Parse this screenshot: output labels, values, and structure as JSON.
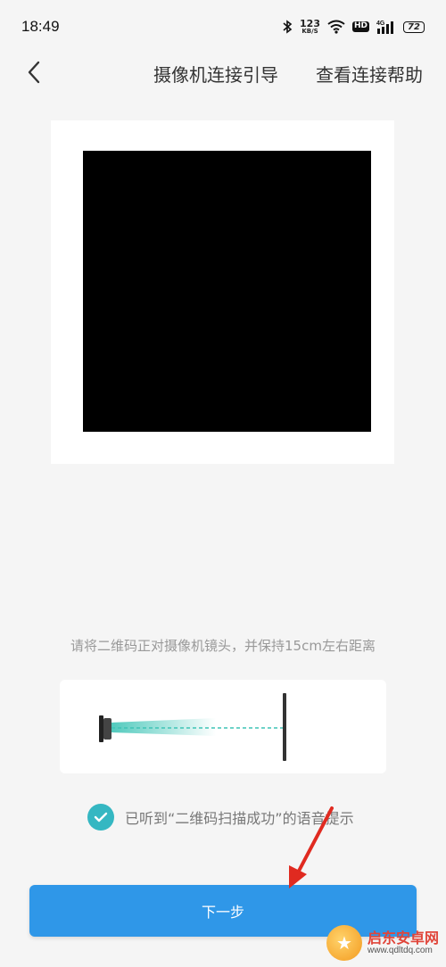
{
  "status_bar": {
    "time": "18:49",
    "speed_value": "123",
    "speed_unit": "KB/S",
    "hd": "HD",
    "network": "4G",
    "battery": "72",
    "icons": [
      "bluetooth-icon",
      "wifi-icon",
      "signal-icon",
      "battery-icon"
    ]
  },
  "header": {
    "back_icon": "chevron-left-icon",
    "title": "摄像机连接引导",
    "help_link": "查看连接帮助"
  },
  "qr": {
    "description": "qr-code"
  },
  "instruction": "请将二维码正对摄像机镜头，并保持15cm左右距离",
  "diagram": {
    "icons": [
      "camera-icon",
      "scan-beam",
      "target-line-icon"
    ]
  },
  "confirm": {
    "checked": true,
    "label": "已听到“二维码扫描成功”的语音提示"
  },
  "next_button": {
    "label": "下一步"
  },
  "watermark": {
    "name": "启东安卓网",
    "url": "www.qdltdq.com"
  },
  "colors": {
    "accent": "#2f97e8",
    "checkbox": "#35b7c2",
    "annotation_arrow": "#e02a20",
    "background": "#f5f5f5"
  }
}
